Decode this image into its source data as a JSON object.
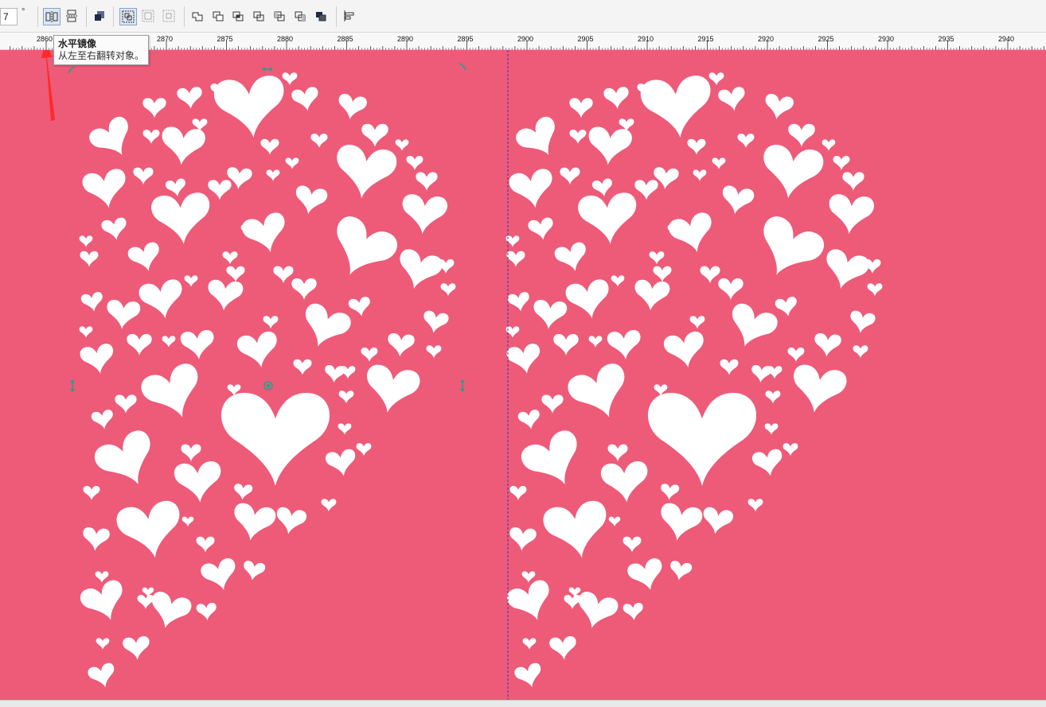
{
  "toolbar": {
    "angle_value": "7",
    "angle_unit": "°",
    "buttons": [
      {
        "name": "mirror-horizontal-button",
        "icon": "mirror-horizontal-icon",
        "active": true
      },
      {
        "name": "mirror-vertical-button",
        "icon": "mirror-vertical-icon",
        "active": false
      },
      {
        "name": "arrange-order-button",
        "icon": "arrange-order-icon",
        "active": false
      },
      {
        "name": "group-objects-button",
        "icon": "group-icon",
        "active": true
      },
      {
        "name": "ungroup-objects-button",
        "icon": "ungroup-icon",
        "active": false
      },
      {
        "name": "ungroup-all-button",
        "icon": "ungroup-all-icon",
        "active": false
      },
      {
        "name": "weld-button",
        "icon": "weld-icon",
        "active": false
      },
      {
        "name": "trim-button",
        "icon": "trim-icon",
        "active": false
      },
      {
        "name": "intersect-button",
        "icon": "intersect-icon",
        "active": false
      },
      {
        "name": "simplify-button",
        "icon": "simplify-icon",
        "active": false
      },
      {
        "name": "front-minus-back-button",
        "icon": "front-minus-back-icon",
        "active": false
      },
      {
        "name": "back-minus-front-button",
        "icon": "back-minus-front-icon",
        "active": false
      },
      {
        "name": "create-boundary-button",
        "icon": "boundary-icon",
        "active": false
      },
      {
        "name": "align-distribute-button",
        "icon": "align-icon",
        "active": false
      }
    ]
  },
  "tooltip": {
    "title": "水平镜像",
    "description": "从左至右翻转对象。"
  },
  "ruler": {
    "labels": [
      "2860",
      "2870",
      "2875",
      "2880",
      "2885",
      "2890",
      "2895",
      "2900",
      "2905",
      "2910",
      "2915",
      "2920",
      "2925",
      "2930",
      "2935",
      "2940"
    ]
  },
  "canvas": {
    "background_color": "#ed5b78",
    "shape_color": "#ffffff",
    "handle_color": "#2a9d8f",
    "guide_color": "#3a3aa8",
    "annotation_color": "#ff2a2a"
  }
}
